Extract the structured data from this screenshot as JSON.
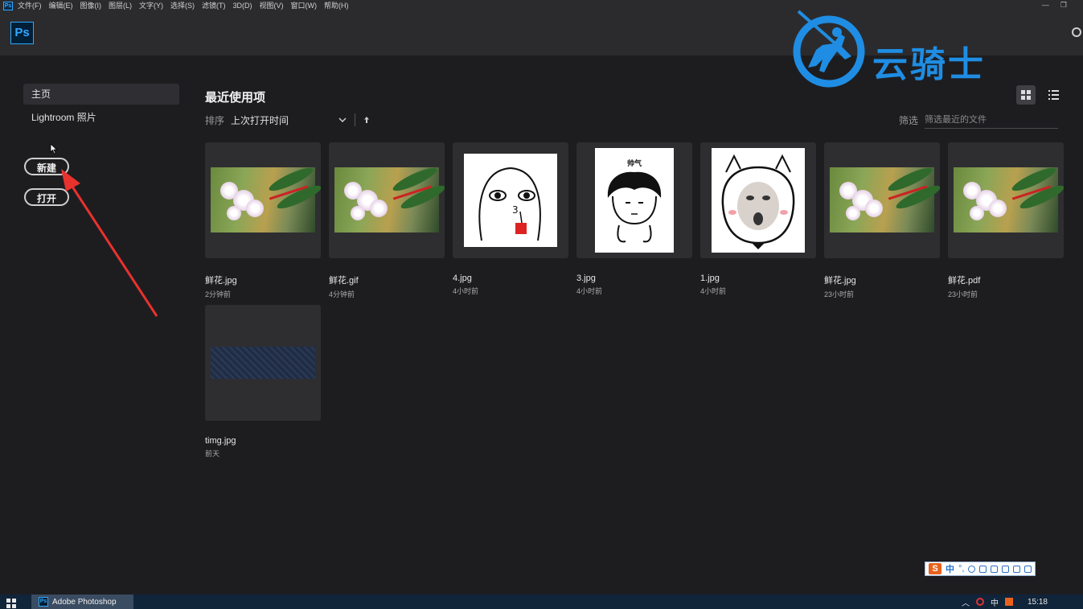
{
  "menubar": {
    "app_icon": "Ps",
    "items": [
      "文件(F)",
      "编辑(E)",
      "图像(I)",
      "图层(L)",
      "文字(Y)",
      "选择(S)",
      "滤镜(T)",
      "3D(D)",
      "视图(V)",
      "窗口(W)",
      "帮助(H)"
    ],
    "window_controls": [
      "—",
      "❐"
    ]
  },
  "app": {
    "logo": "Ps"
  },
  "watermark": {
    "text": "云骑士"
  },
  "sidebar": {
    "items": [
      {
        "label": "主页",
        "active": true
      },
      {
        "label": "Lightroom 照片",
        "active": false
      }
    ],
    "new_button": "新建",
    "open_button": "打开"
  },
  "main": {
    "title": "最近使用项",
    "sort_label": "排序",
    "sort_value": "上次打开时间",
    "filter_label": "筛选",
    "filter_placeholder": "筛选最近的文件"
  },
  "files": [
    {
      "name": "鲜花.jpg",
      "time": "2分钟前",
      "thumb": "flower"
    },
    {
      "name": "鲜花.gif",
      "time": "4分钟前",
      "thumb": "flower"
    },
    {
      "name": "4.jpg",
      "time": "4小时前",
      "thumb": "meme-drink"
    },
    {
      "name": "3.jpg",
      "time": "4小时前",
      "thumb": "meme-shuai",
      "thumb_text": "帅气"
    },
    {
      "name": "1.jpg",
      "time": "4小时前",
      "thumb": "meme-cat"
    },
    {
      "name": "鲜花.jpg",
      "time": "23小时前",
      "thumb": "flower"
    },
    {
      "name": "鲜花.pdf",
      "time": "23小时前",
      "thumb": "flower"
    },
    {
      "name": "timg.jpg",
      "time": "前天",
      "thumb": "rock"
    }
  ],
  "taskbar": {
    "app_label": "Adobe Photoshop",
    "tray_ime": "中",
    "clock": "15:18"
  },
  "ime_bar": {
    "lang": "中"
  },
  "colors": {
    "accent": "#31a8ff",
    "annotation": "#e8322e",
    "watermark": "#1f8de3"
  }
}
